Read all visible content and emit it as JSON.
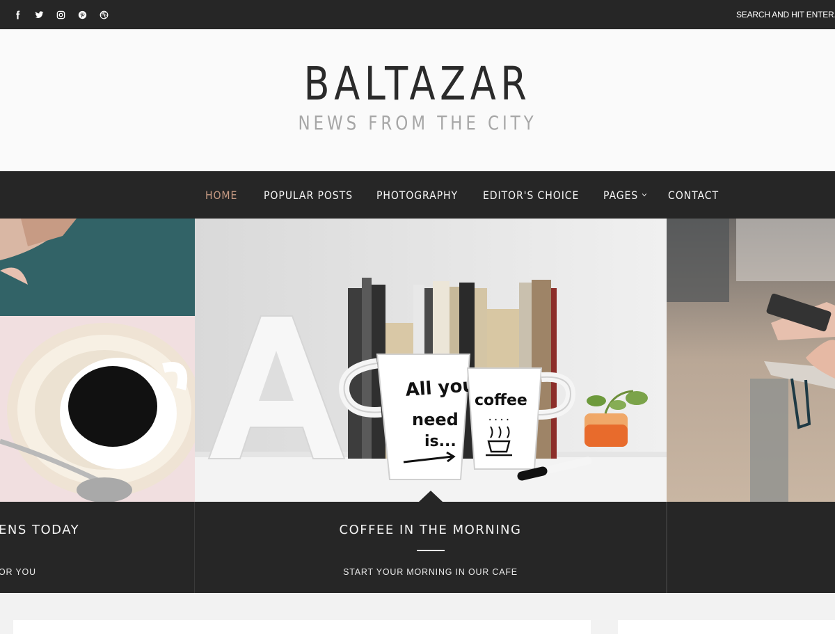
{
  "topbar": {
    "social": [
      {
        "icon": "facebook-icon"
      },
      {
        "icon": "twitter-icon"
      },
      {
        "icon": "instagram-icon"
      },
      {
        "icon": "pinterest-icon"
      },
      {
        "icon": "dribbble-icon"
      }
    ],
    "search_placeholder": "SEARCH AND HIT ENTER..."
  },
  "header": {
    "title": "BALTAZAR",
    "tagline": "NEWS FROM THE CITY"
  },
  "nav": {
    "items": [
      {
        "label": "HOME",
        "active": true
      },
      {
        "label": "POPULAR POSTS"
      },
      {
        "label": "PHOTOGRAPHY"
      },
      {
        "label": "EDITOR'S CHOICE"
      },
      {
        "label": "PAGES",
        "has_dropdown": true
      },
      {
        "label": "CONTACT"
      }
    ],
    "active_color": "#c79b84"
  },
  "slider": {
    "slides": [
      {
        "title": "ENS TODAY",
        "subtitle": "OR YOU"
      },
      {
        "title": "COFFEE IN THE MORNING",
        "subtitle": "START YOUR MORNING IN OUR CAFE"
      },
      {
        "title": "",
        "subtitle": ""
      }
    ]
  },
  "colors": {
    "dark": "#262626",
    "header_bg": "#fafafa",
    "page_bg": "#f2f2f2"
  }
}
